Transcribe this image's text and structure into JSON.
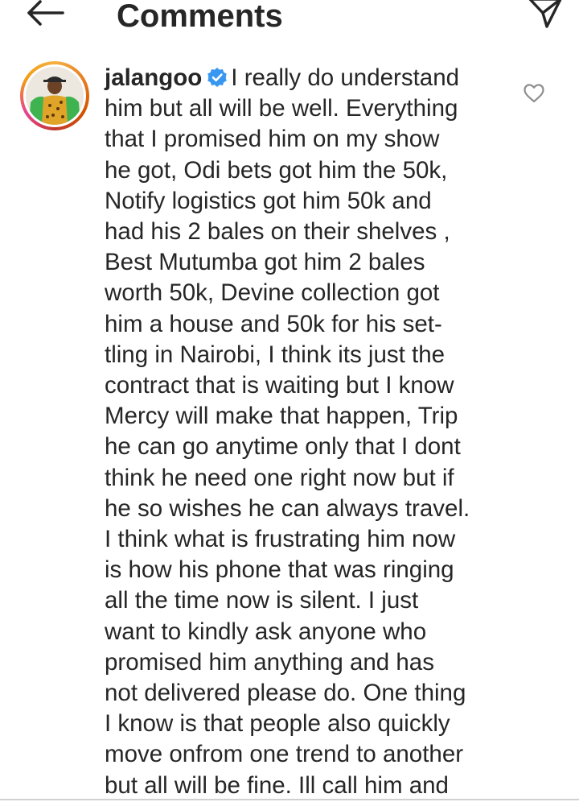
{
  "header": {
    "title": "Comments",
    "back_icon": "arrow-left-icon",
    "send_icon": "paper-plane-icon"
  },
  "comment": {
    "username": "jalangoo",
    "verified_icon": "verified-badge-icon",
    "like_icon": "heart-outline-icon",
    "text_lines": [
      "I really do understand",
      "him but all will be well. Everything",
      "that I promised him on my show",
      "he got, Odi bets got him the 50k,",
      "Notify logistics got him 50k and",
      "had his 2 bales on their shelves ,",
      "Best Mutumba got him 2 bales",
      "worth 50k, Devine collection got",
      "him a house and 50k for his set-",
      "tling in Nairobi, I think its just the",
      "contract that is waiting but I know",
      "Mercy will make that happen, Trip",
      "he can go anytime only that I dont",
      "think he need one right now but if",
      "he so wishes he can always travel.",
      "I think what is frustrating him now",
      "is how his phone that was ringing",
      "all the time now is silent. I just",
      "want to kindly ask anyone who",
      "promised him anything and has",
      "not delivered please do. One thing",
      "I know is that people also quickly",
      "move onfrom one trend to another",
      "but all will be fine. Ill call him and"
    ]
  },
  "colors": {
    "text": "#262626",
    "verified_blue": "#3897f0",
    "icon_gray": "#8e8e8e"
  }
}
